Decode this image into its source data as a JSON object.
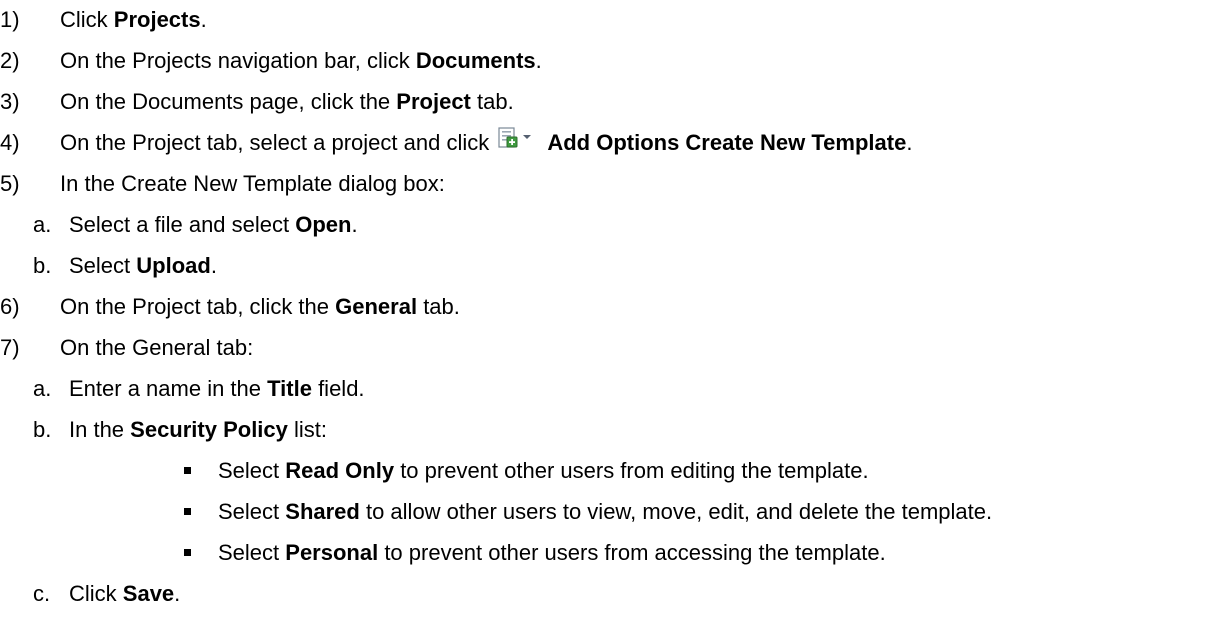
{
  "steps": [
    {
      "num": "1)",
      "pre": "Click ",
      "bold": "Projects",
      "post": "."
    },
    {
      "num": "2)",
      "pre": "On the Projects navigation bar, click ",
      "bold": "Documents",
      "post": "."
    },
    {
      "num": "3)",
      "pre": "On the Documents page, click the ",
      "bold": "Project",
      "post": " tab."
    },
    {
      "num": "4)",
      "pre": "On the Project tab, select a project and click ",
      "icon": "add-document-dropdown-icon",
      "bold": "Add Options Create New Template",
      "post": "."
    },
    {
      "num": "5)",
      "pre": "In the Create New Template dialog box:"
    },
    {
      "num": "a.",
      "pre": "Select a file and select ",
      "bold": "Open",
      "post": "."
    },
    {
      "num": "b.",
      "pre": "Select ",
      "bold": "Upload",
      "post": "."
    },
    {
      "num": "6)",
      "pre": "On the Project tab, click the ",
      "bold": "General",
      "post": " tab."
    },
    {
      "num": "7)",
      "pre": "On the General tab:"
    },
    {
      "num": "a.",
      "pre": "Enter a name in the ",
      "bold": "Title",
      "post": " field."
    },
    {
      "num": "b.",
      "pre": "In the ",
      "bold": "Security Policy",
      "post": " list:"
    },
    {
      "pre": "Select ",
      "bold": "Read Only",
      "post": " to prevent other users from editing the template."
    },
    {
      "pre": "Select ",
      "bold": "Shared",
      "post": " to allow other users to view, move, edit, and delete the template."
    },
    {
      "pre": "Select ",
      "bold": "Personal",
      "post": " to prevent other users from accessing the template."
    },
    {
      "num": "c.",
      "pre": "Click ",
      "bold": "Save",
      "post": "."
    }
  ]
}
